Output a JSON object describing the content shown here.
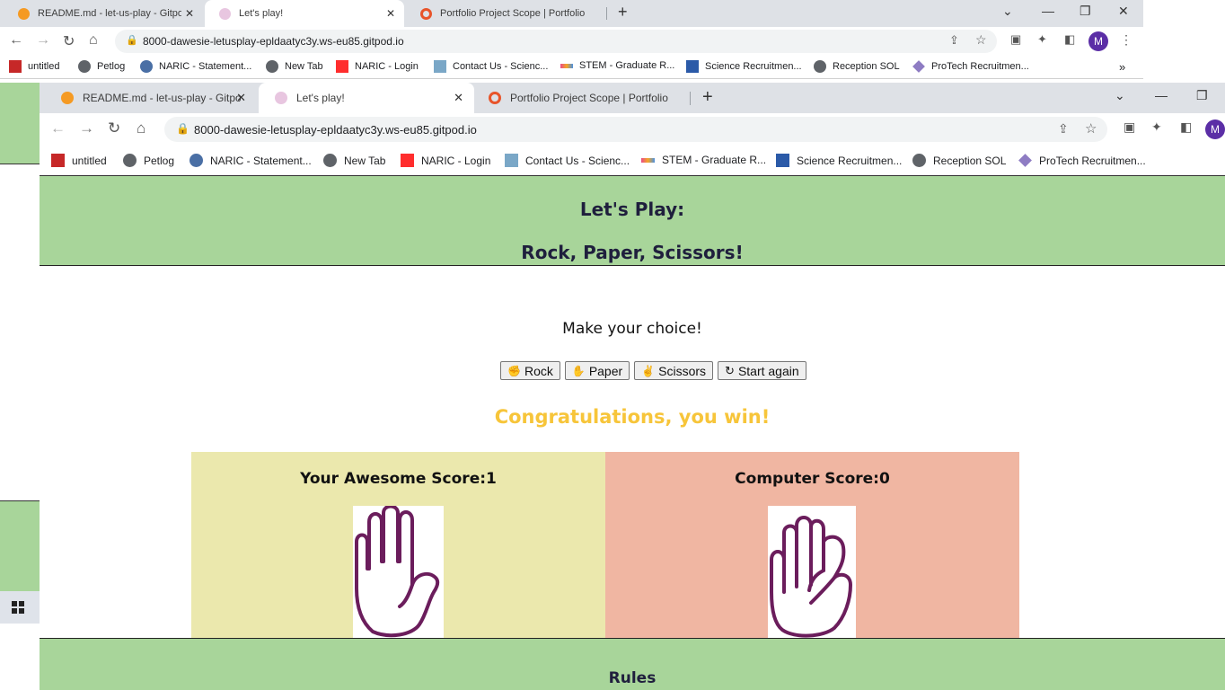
{
  "outer_browser": {
    "tabs": [
      {
        "title": "README.md - let-us-play - Gitpo",
        "active": false
      },
      {
        "title": "Let's play!",
        "active": true
      },
      {
        "title": "Portfolio Project Scope | Portfolio",
        "active": false
      }
    ],
    "url": "8000-dawesie-letusplay-epldaatyc3y.ws-eu85.gitpod.io",
    "bookmarks": [
      "untitled",
      "Petlog",
      "NARIC - Statement...",
      "New Tab",
      "NARIC - Login",
      "Contact Us - Scienc...",
      "STEM - Graduate R...",
      "Science Recruitmen...",
      "Reception SOL",
      "ProTech Recruitmen..."
    ],
    "avatar": "M"
  },
  "inner_browser": {
    "tabs": [
      {
        "title": "README.md - let-us-play - Gitpo",
        "active": false
      },
      {
        "title": "Let's play!",
        "active": true
      },
      {
        "title": "Portfolio Project Scope | Portfolio",
        "active": false
      }
    ],
    "url": "8000-dawesie-letusplay-epldaatyc3y.ws-eu85.gitpod.io",
    "bookmarks": [
      "untitled",
      "Petlog",
      "NARIC - Statement...",
      "New Tab",
      "NARIC - Login",
      "Contact Us - Scienc...",
      "STEM - Graduate R...",
      "Science Recruitmen...",
      "Reception SOL",
      "ProTech Recruitmen..."
    ],
    "avatar": "M"
  },
  "page": {
    "title_line1": "Let's Play:",
    "title_line2": "Rock, Paper, Scissors!",
    "choice_prompt": "Make your choice!",
    "buttons": {
      "rock": "Rock",
      "paper": "Paper",
      "scissors": "Scissors",
      "restart": "Start again"
    },
    "result": "Congratulations, you win!",
    "player_score_label": "Your Awesome Score:1",
    "computer_score_label": "Computer Score:0",
    "player_choice_icon": "paper-hand-icon",
    "computer_choice_icon": "rock-fist-icon",
    "rules_heading": "Rules"
  },
  "colors": {
    "header_green": "#a8d59a",
    "result_yellow": "#f7c53a",
    "player_panel": "#ebe8ad",
    "computer_panel": "#f0b6a2",
    "hand_stroke": "#6b1d5c",
    "title_text": "#1f1f3d"
  }
}
